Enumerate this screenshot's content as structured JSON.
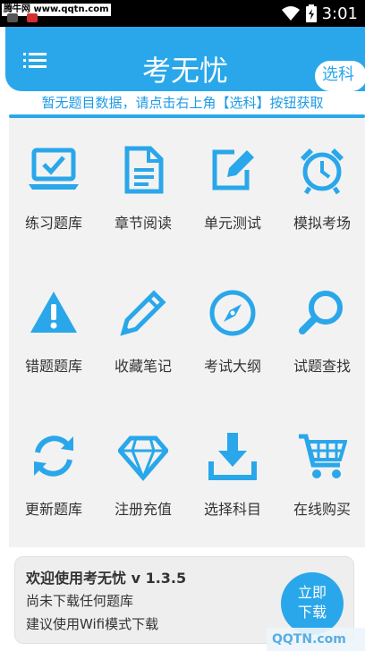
{
  "statusbar": {
    "watermark": "腾牛网 www.qqtn.com",
    "time": "3:01",
    "wifi_icon": "wifi-icon",
    "battery_icon": "battery-icon"
  },
  "header": {
    "title": "考无忧",
    "subject_button": "选科",
    "menu_icon": "menu-icon"
  },
  "notice": "暂无题目数据，请点击右上角【选科】按钮获取",
  "grid": [
    {
      "label": "练习题库",
      "icon": "laptop-check-icon"
    },
    {
      "label": "章节阅读",
      "icon": "document-icon"
    },
    {
      "label": "单元测试",
      "icon": "edit-icon"
    },
    {
      "label": "模拟考场",
      "icon": "alarm-clock-icon"
    },
    {
      "label": "错题题库",
      "icon": "warning-icon"
    },
    {
      "label": "收藏笔记",
      "icon": "pen-icon"
    },
    {
      "label": "考试大纲",
      "icon": "compass-icon"
    },
    {
      "label": "试题查找",
      "icon": "search-icon"
    },
    {
      "label": "更新题库",
      "icon": "refresh-icon"
    },
    {
      "label": "注册充值",
      "icon": "diamond-icon"
    },
    {
      "label": "选择科目",
      "icon": "download-icon"
    },
    {
      "label": "在线购买",
      "icon": "cart-icon"
    }
  ],
  "welcome": {
    "line1": "欢迎使用考无忧 v 1.3.5",
    "line2": "尚未下载任何题库",
    "line3": "建议使用Wifi模式下载",
    "download_button_line1": "立即",
    "download_button_line2": "下载"
  },
  "corner_watermark": "QQTN.com",
  "colors": {
    "primary": "#29a7ea",
    "grid_bg": "#f2f2f2",
    "text": "#333333"
  }
}
